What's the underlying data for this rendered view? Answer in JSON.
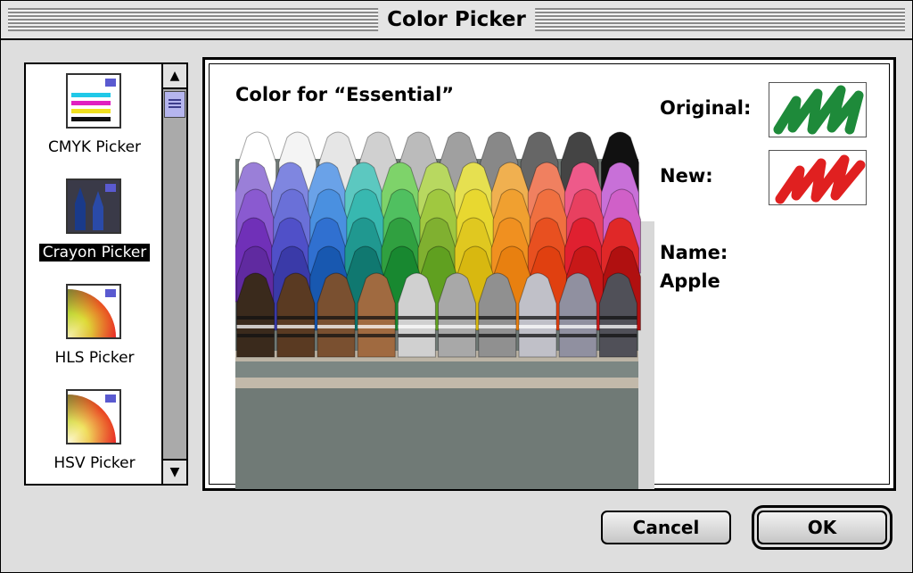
{
  "window": {
    "title": "Color Picker"
  },
  "pickers": [
    {
      "label": "CMYK Picker",
      "icon": "cmyk-icon",
      "selected": false
    },
    {
      "label": "Crayon Picker",
      "icon": "crayon-icon",
      "selected": true
    },
    {
      "label": "HLS Picker",
      "icon": "hls-wheel-icon",
      "selected": false
    },
    {
      "label": "HSV Picker",
      "icon": "hsv-wheel-icon",
      "selected": false
    }
  ],
  "panel": {
    "heading": "Color for “Essential”",
    "original_label": "Original:",
    "new_label": "New:",
    "name_label": "Name:",
    "name_value": "Apple",
    "original_color": "#1e8a3a",
    "new_color": "#e02020"
  },
  "buttons": {
    "cancel": "Cancel",
    "ok": "OK"
  }
}
